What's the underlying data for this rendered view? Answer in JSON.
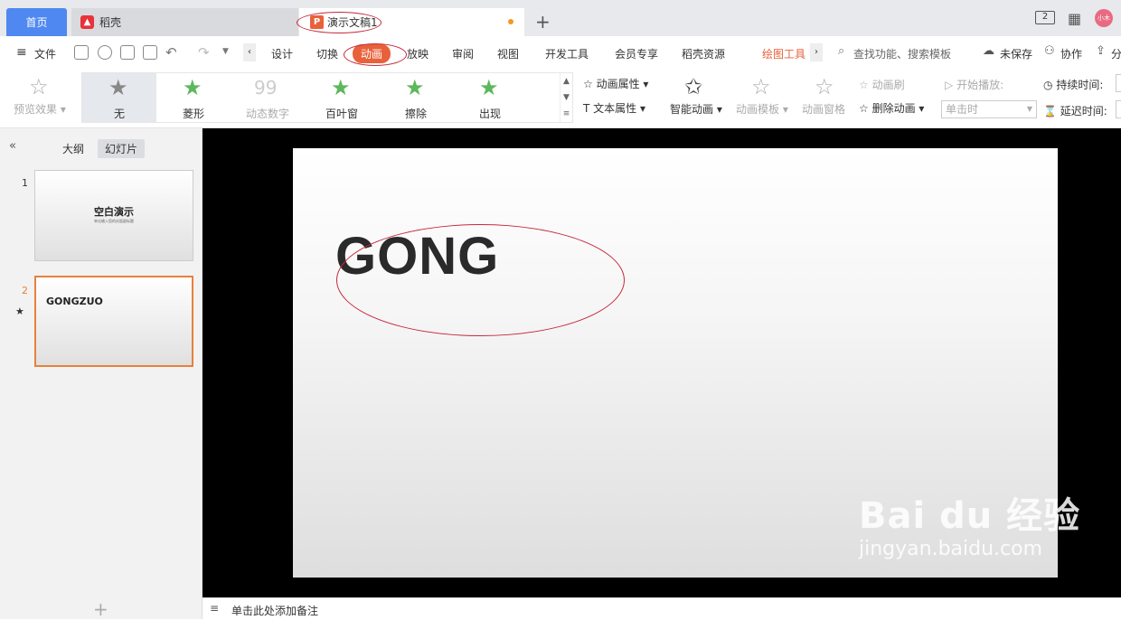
{
  "tabs": {
    "home": "首页",
    "daoke": "稻壳",
    "doc": "演示文稿1",
    "page_count": "2",
    "avatar": "小木"
  },
  "menu": {
    "file": "文件",
    "items": [
      "设计",
      "切换",
      "动画",
      "放映",
      "审阅",
      "视图",
      "开发工具",
      "会员专享",
      "稻壳资源"
    ],
    "drawing_tools": "绘图工具",
    "search": "查找功能、搜索模板",
    "unsaved": "未保存",
    "collab": "协作",
    "share": "分"
  },
  "ribbon": {
    "preview": "预览效果",
    "effects": [
      "无",
      "菱形",
      "动态数字",
      "百叶窗",
      "擦除",
      "出现"
    ],
    "anim_props": "动画属性",
    "text_props": "文本属性",
    "smart_anim": "智能动画",
    "anim_template": "动画模板",
    "anim_pane": "动画窗格",
    "anim_brush": "动画刷",
    "delete_anim": "删除动画",
    "start_play": "开始播放:",
    "start_value": "单击时",
    "duration": "持续时间:",
    "delay": "延迟时间:"
  },
  "leftpane": {
    "outline": "大纲",
    "slides": "幻灯片",
    "slide1_num": "1",
    "slide1_title": "空白演示",
    "slide1_sub": "单击输入您的封面副标题",
    "slide2_num": "2",
    "slide2_title": "GONGZUO"
  },
  "slide": {
    "text": "GONGZUO"
  },
  "notes": "单击此处添加备注",
  "watermark": {
    "brand": "Bai du 经验",
    "url": "jingyan.baidu.com"
  },
  "colors": {
    "accent": "#e8613a",
    "home_tab": "#4f88f0",
    "annotation": "#c6283a"
  }
}
